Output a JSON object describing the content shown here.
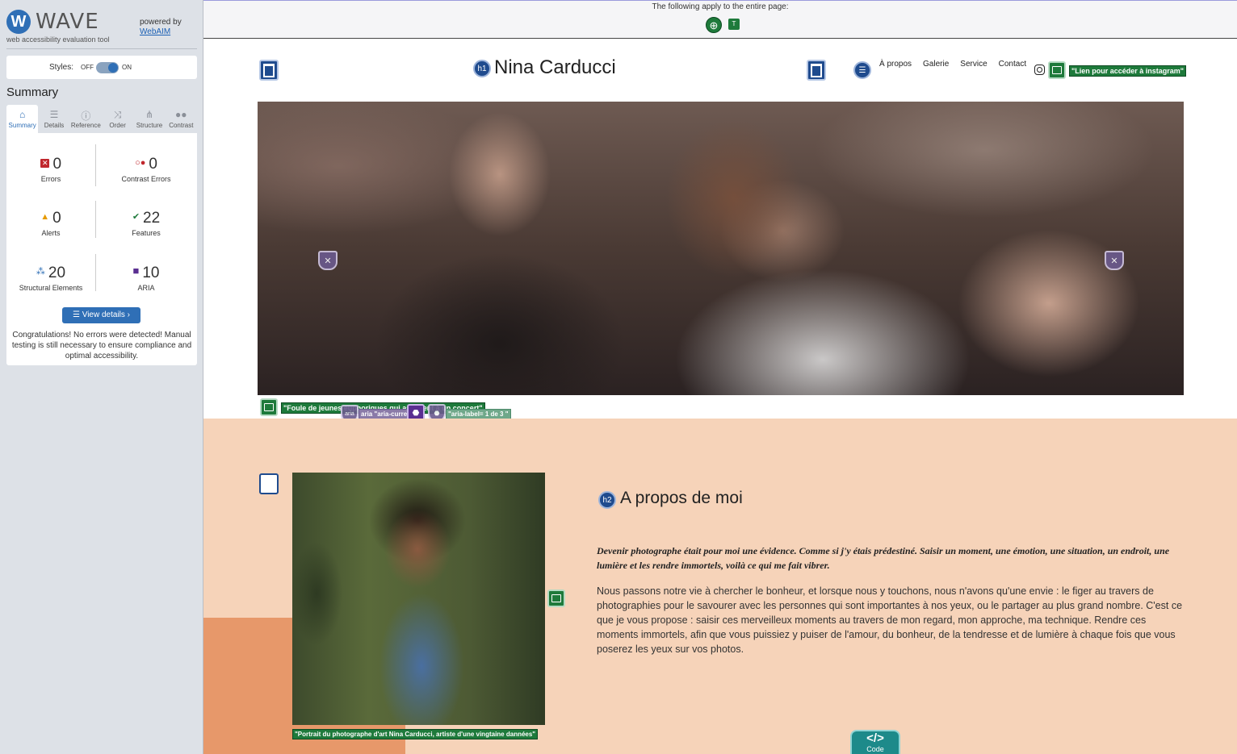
{
  "wave": {
    "brand": "WAVE",
    "tagline": "web accessibility evaluation tool",
    "powered_by": "powered by",
    "powered_link": "WebAIM",
    "styles_label": "Styles:",
    "styles_off": "OFF",
    "styles_on": "ON",
    "summary_title": "Summary",
    "tabs": [
      {
        "label": "Summary",
        "icon": "home-icon"
      },
      {
        "label": "Details",
        "icon": "list-icon"
      },
      {
        "label": "Reference",
        "icon": "info-icon"
      },
      {
        "label": "Order",
        "icon": "order-icon"
      },
      {
        "label": "Structure",
        "icon": "structure-icon"
      },
      {
        "label": "Contrast",
        "icon": "contrast-icon"
      }
    ],
    "stats": {
      "errors": {
        "value": "0",
        "label": "Errors",
        "color": "#c0272d"
      },
      "contrast_errors": {
        "value": "0",
        "label": "Contrast Errors",
        "color": "#c0272d"
      },
      "alerts": {
        "value": "0",
        "label": "Alerts",
        "color": "#e69a00"
      },
      "features": {
        "value": "22",
        "label": "Features",
        "color": "#1e7a3b"
      },
      "structural": {
        "value": "20",
        "label": "Structural Elements",
        "color": "#2f6fb6"
      },
      "aria": {
        "value": "10",
        "label": "ARIA",
        "color": "#5a2f91"
      }
    },
    "view_details": "View details ›",
    "congrats": "Congratulations! No errors were detected! Manual testing is still necessary to ensure compliance and optimal accessibility."
  },
  "topbar": {
    "text": "The following apply to the entire page:"
  },
  "site": {
    "title": "Nina Carducci",
    "h1_badge": "h1",
    "nav": [
      "À propos",
      "Galerie",
      "Service",
      "Contact"
    ],
    "instagram_label": "\"Lien pour accéder à instagram\"",
    "hero_alt_label": "\"Foule de jeunes euphoriques qui assistent à un concert\"",
    "hero_aria_current": "aria \"aria-current\"",
    "hero_aria_label": "\"aria-label= 1 de 3 \"",
    "about": {
      "h2_badge": "h2",
      "title": "A propos de moi",
      "lead": "Devenir photographe était pour moi une évidence. Comme si j'y étais prédestiné. Saisir un moment, une émotion, une situation, un endroit, une lumière et les rendre immortels, voilà ce qui me fait vibrer.",
      "body": "Nous passons notre vie à chercher le bonheur, et lorsque nous y touchons, nous n'avons qu'une envie : le figer au travers de photographies pour le savourer avec les personnes qui sont importantes à nos yeux, ou le partager au plus grand nombre. C'est ce que je vous propose : saisir ces merveilleux moments au travers de mon regard, mon approche, ma technique. Rendre ces moments immortels, afin que vous puissiez y puiser de l'amour, du bonheur, de la tendresse et de lumière à chaque fois que vous poserez les yeux sur vos photos.",
      "portrait_label": "\"Portrait du photographe d'art Nina Carducci, artiste d'une vingtaine dannées\""
    },
    "code_button": "Code",
    "code_glyph": "</>"
  }
}
